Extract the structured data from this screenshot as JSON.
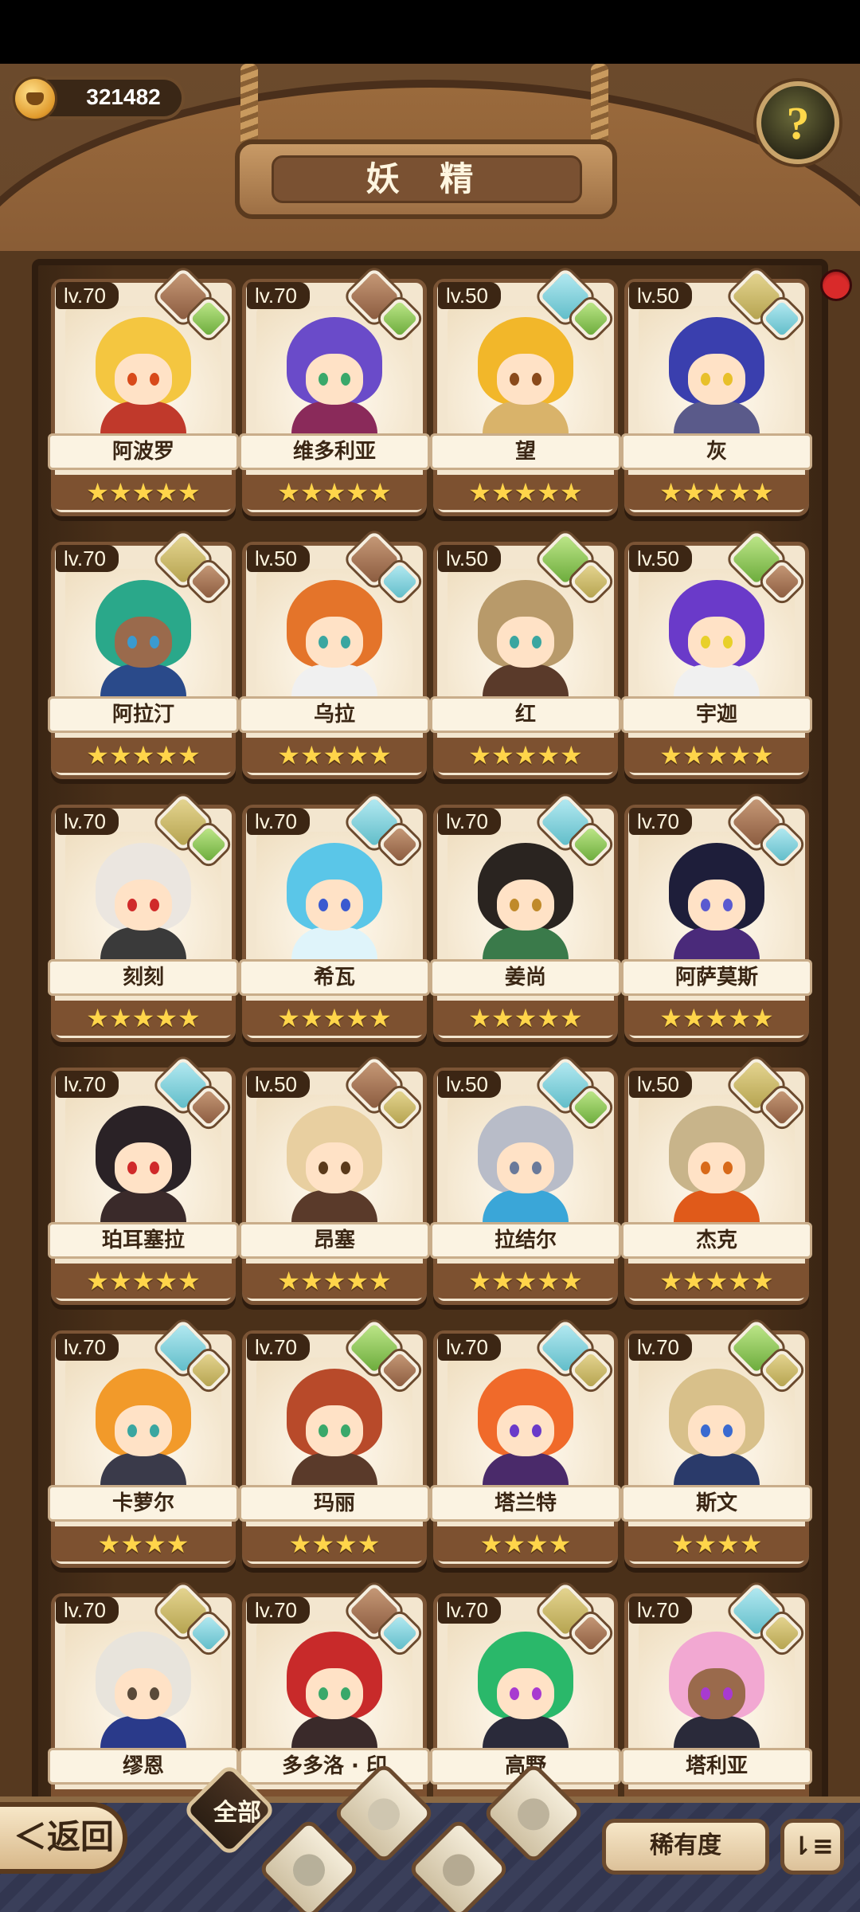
{
  "currency": {
    "value": "321482"
  },
  "header": {
    "title": "妖 精",
    "help_symbol": "?"
  },
  "cards": [
    {
      "level": "lv.70",
      "name": "阿波罗",
      "stars": "★★★★★",
      "main": "earth",
      "sub": "plant",
      "hair": "#f4c640",
      "eyes": "#d84a1a",
      "outfit": "#c0392b",
      "dark": false
    },
    {
      "level": "lv.70",
      "name": "维多利亚",
      "stars": "★★★★★",
      "main": "earth",
      "sub": "plant",
      "hair": "#6a4bc9",
      "eyes": "#3aa86a",
      "outfit": "#8a2a5a",
      "dark": false
    },
    {
      "level": "lv.50",
      "name": "望",
      "stars": "★★★★★",
      "main": "water",
      "sub": "plant",
      "hair": "#f2b72a",
      "eyes": "#8a4a1a",
      "outfit": "#d9b36a",
      "dark": false
    },
    {
      "level": "lv.50",
      "name": "灰",
      "stars": "★★★★★",
      "main": "sand",
      "sub": "water",
      "hair": "#3a3fae",
      "eyes": "#e8c02a",
      "outfit": "#5a5a8a",
      "dark": false
    },
    {
      "level": "lv.70",
      "name": "阿拉汀",
      "stars": "★★★★★",
      "main": "sand",
      "sub": "earth",
      "hair": "#2aa88a",
      "eyes": "#3a9ad0",
      "outfit": "#2a4a8a",
      "dark": true
    },
    {
      "level": "lv.50",
      "name": "乌拉",
      "stars": "★★★★★",
      "main": "earth",
      "sub": "water",
      "hair": "#e4742a",
      "eyes": "#3aa6a0",
      "outfit": "#f0f0f0",
      "dark": false
    },
    {
      "level": "lv.50",
      "name": "红",
      "stars": "★★★★★",
      "main": "plant",
      "sub": "sand",
      "hair": "#b89a6a",
      "eyes": "#3aa6a0",
      "outfit": "#5a3a2a",
      "dark": false
    },
    {
      "level": "lv.50",
      "name": "宇迦",
      "stars": "★★★★★",
      "main": "plant",
      "sub": "earth",
      "hair": "#6a3ac9",
      "eyes": "#e8d02a",
      "outfit": "#f0f0f0",
      "dark": false
    },
    {
      "level": "lv.70",
      "name": "刻刻",
      "stars": "★★★★★",
      "main": "sand",
      "sub": "plant",
      "hair": "#ebe6e0",
      "eyes": "#d02a2a",
      "outfit": "#3a3a3a",
      "dark": false
    },
    {
      "level": "lv.70",
      "name": "希瓦",
      "stars": "★★★★★",
      "main": "water",
      "sub": "earth",
      "hair": "#5ac6e8",
      "eyes": "#3a5ad0",
      "outfit": "#dff4fa",
      "dark": false
    },
    {
      "level": "lv.70",
      "name": "姜尚",
      "stars": "★★★★★",
      "main": "water",
      "sub": "plant",
      "hair": "#2a2420",
      "eyes": "#c08a2a",
      "outfit": "#3a7a4a",
      "dark": false
    },
    {
      "level": "lv.70",
      "name": "阿萨莫斯",
      "stars": "★★★★★",
      "main": "earth",
      "sub": "water",
      "hair": "#1e1e3a",
      "eyes": "#5a5ad0",
      "outfit": "#4a2a7a",
      "dark": false
    },
    {
      "level": "lv.70",
      "name": "珀耳塞拉",
      "stars": "★★★★★",
      "main": "water",
      "sub": "earth",
      "hair": "#2a2226",
      "eyes": "#d02a2a",
      "outfit": "#3a2a2a",
      "dark": false
    },
    {
      "level": "lv.50",
      "name": "昂塞",
      "stars": "★★★★★",
      "main": "earth",
      "sub": "sand",
      "hair": "#e8cfa0",
      "eyes": "#5a3a1a",
      "outfit": "#5a3a2a",
      "dark": false
    },
    {
      "level": "lv.50",
      "name": "拉结尔",
      "stars": "★★★★★",
      "main": "water",
      "sub": "plant",
      "hair": "#b8bcc8",
      "eyes": "#6a7a9a",
      "outfit": "#3aa6d8",
      "dark": false
    },
    {
      "level": "lv.50",
      "name": "杰克",
      "stars": "★★★★★",
      "main": "sand",
      "sub": "earth",
      "hair": "#c8b48a",
      "eyes": "#d86a1a",
      "outfit": "#e05a1a",
      "dark": false
    },
    {
      "level": "lv.70",
      "name": "卡萝尔",
      "stars": "★★★★",
      "main": "water",
      "sub": "sand",
      "hair": "#f29a2a",
      "eyes": "#3aa6a0",
      "outfit": "#3a3a4a",
      "dark": false
    },
    {
      "level": "lv.70",
      "name": "玛丽",
      "stars": "★★★★",
      "main": "plant",
      "sub": "earth",
      "hair": "#b84a2a",
      "eyes": "#3aa86a",
      "outfit": "#5a3a2a",
      "dark": false
    },
    {
      "level": "lv.70",
      "name": "塔兰特",
      "stars": "★★★★",
      "main": "water",
      "sub": "sand",
      "hair": "#f06a2a",
      "eyes": "#6a3ac9",
      "outfit": "#4a2a6a",
      "dark": false
    },
    {
      "level": "lv.70",
      "name": "斯文",
      "stars": "★★★★",
      "main": "plant",
      "sub": "sand",
      "hair": "#d8c08a",
      "eyes": "#3a6ad0",
      "outfit": "#2a3a6a",
      "dark": false
    },
    {
      "level": "lv.70",
      "name": "缪恩",
      "stars": "★★★★",
      "main": "sand",
      "sub": "water",
      "hair": "#e8e4dc",
      "eyes": "#5a4a3a",
      "outfit": "#2a3a8a",
      "dark": false
    },
    {
      "level": "lv.70",
      "name": "多多洛 · 印",
      "stars": "★★★★",
      "main": "earth",
      "sub": "water",
      "hair": "#c82a2a",
      "eyes": "#3aa86a",
      "outfit": "#3a2a2a",
      "dark": false
    },
    {
      "level": "lv.70",
      "name": "高野",
      "stars": "★★★★",
      "main": "sand",
      "sub": "earth",
      "hair": "#2ab86a",
      "eyes": "#a83ad0",
      "outfit": "#2a2a3a",
      "dark": false
    },
    {
      "level": "lv.70",
      "name": "塔利亚",
      "stars": "★★★★",
      "main": "water",
      "sub": "sand",
      "hair": "#f2a8d2",
      "eyes": "#a83ad0",
      "outfit": "#2a2a3a",
      "dark": true
    }
  ],
  "bottom": {
    "back_label": "＜返回",
    "tab_all_label": "全部",
    "rarity_label": "稀有度",
    "sort_icon_glyph": "⇂≡"
  },
  "icons": {
    "coin": "coin-icon",
    "help": "question-icon",
    "ladybug": "ladybug-icon",
    "tabs": [
      "plant-filter-icon",
      "water-filter-icon",
      "earth-filter-icon",
      "mountain-filter-icon"
    ]
  },
  "colors": {
    "star": "#ffd54a",
    "card_background": "#f3e6cf",
    "wood": "#7b5435",
    "level_tag": "#3c2614"
  }
}
